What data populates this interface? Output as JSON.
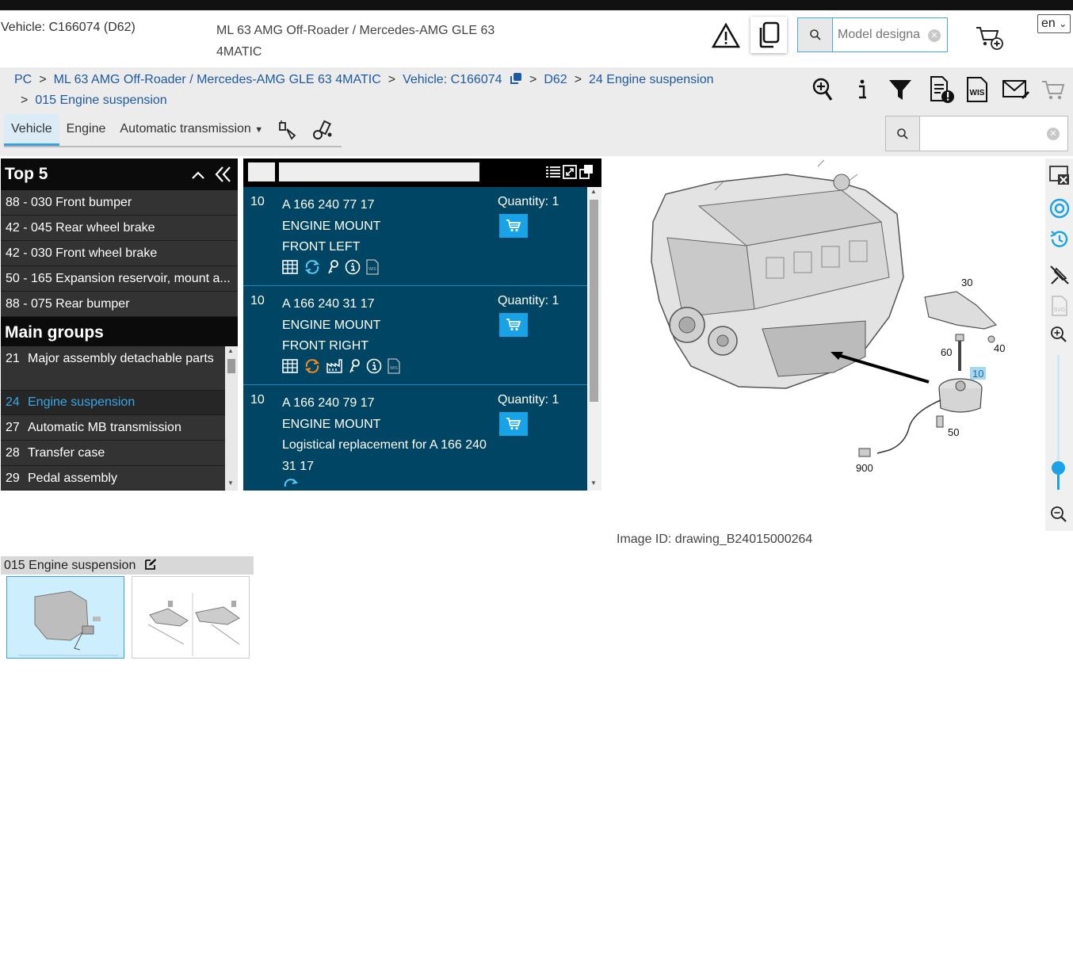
{
  "header": {
    "vehicle": "Vehicle: C166074 (D62)",
    "model": "ML 63 AMG Off-Roader / Mercedes-AMG GLE 63 4MATIC",
    "search_placeholder": "Model designa",
    "language": "en"
  },
  "breadcrumb": {
    "items": [
      "PC",
      "ML 63 AMG Off-Roader / Mercedes-AMG GLE 63 4MATIC",
      "Vehicle: C166074",
      "D62",
      "24 Engine suspension",
      "015 Engine suspension"
    ]
  },
  "tabs": {
    "vehicle": "Vehicle",
    "engine": "Engine",
    "transmission": "Automatic transmission"
  },
  "top5": {
    "title": "Top 5",
    "items": [
      "88 - 030 Front bumper",
      "42 - 045 Rear wheel brake",
      "42 - 030 Front wheel brake",
      "50 - 165 Expansion reservoir, mount a...",
      "88 - 075 Rear bumper"
    ]
  },
  "main_groups": {
    "title": "Main groups",
    "items": [
      {
        "num": "21",
        "label": "Major assembly detachable parts"
      },
      {
        "num": "24",
        "label": "Engine suspension"
      },
      {
        "num": "27",
        "label": "Automatic MB transmission"
      },
      {
        "num": "28",
        "label": "Transfer case"
      },
      {
        "num": "29",
        "label": "Pedal assembly"
      }
    ]
  },
  "parts": [
    {
      "pos": "10",
      "number": "A 166 240 77 17",
      "name": "ENGINE MOUNT",
      "note": "FRONT LEFT",
      "qty": "Quantity: 1"
    },
    {
      "pos": "10",
      "number": "A 166 240 31 17",
      "name": "ENGINE MOUNT",
      "note": "FRONT RIGHT",
      "qty": "Quantity: 1"
    },
    {
      "pos": "10",
      "number": "A 166 240 79 17",
      "name": "ENGINE MOUNT",
      "note": "Logistical replacement for A 166 240 31 17",
      "qty": "Quantity: 1"
    }
  ],
  "drawing": {
    "callouts": [
      "30",
      "40",
      "60",
      "10",
      "50",
      "900"
    ],
    "image_id": "Image ID: drawing_B24015000264"
  },
  "thumbnails": {
    "title": "015 Engine suspension"
  },
  "colors": {
    "accent": "#19a3e6",
    "parts_bg": "#004563",
    "link": "#1e5aa0"
  }
}
